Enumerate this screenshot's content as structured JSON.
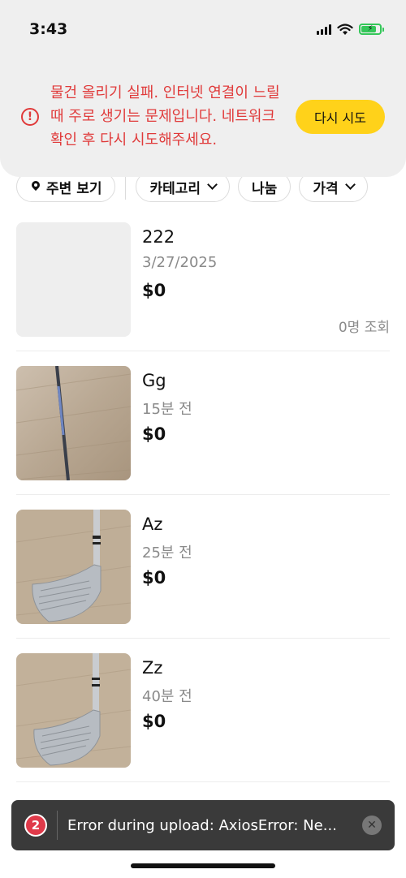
{
  "status_bar": {
    "time": "3:43"
  },
  "banner": {
    "error_icon": "alert-circle-icon",
    "message": "물건 올리기 실패. 인터넷 연결이 느릴때 주로 생기는 문제입니다. 네트워크 확인 후 다시 시도해주세요.",
    "retry_label": "다시 시도",
    "retry_color": "#ffd21a",
    "error_color": "#e03a3a"
  },
  "filters": {
    "nearby": "주변 보기",
    "category": "카테고리",
    "share": "나눔",
    "price": "가격"
  },
  "listings": [
    {
      "title": "222",
      "date": "3/27/2025",
      "price": "$0",
      "views": "0명 조회",
      "image": "placeholder"
    },
    {
      "title": "Gg",
      "date": "15분 전",
      "price": "$0",
      "views": "",
      "image": "golf-shaft"
    },
    {
      "title": "Az",
      "date": "25분 전",
      "price": "$0",
      "views": "",
      "image": "golf-iron"
    },
    {
      "title": "Zz",
      "date": "40분 전",
      "price": "$0",
      "views": "",
      "image": "golf-iron"
    }
  ],
  "toast": {
    "count": "2",
    "message": "Error during upload: AxiosError: Ne..."
  }
}
